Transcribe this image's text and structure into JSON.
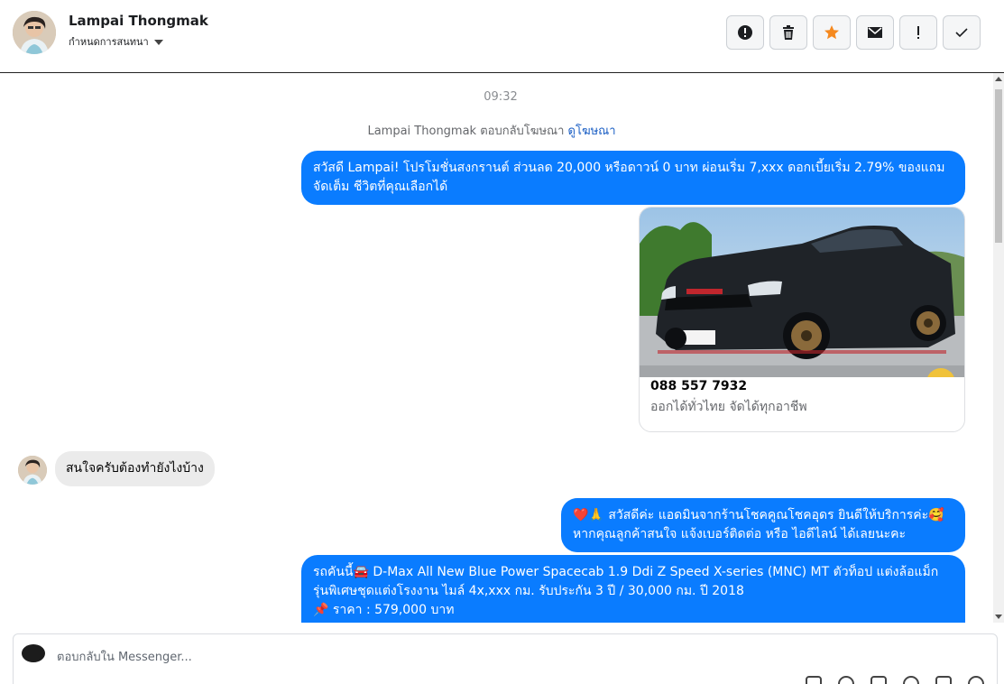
{
  "header": {
    "contact_name": "Lampai Thongmak",
    "assign_label": "กำหนดการสนทนา",
    "actions": [
      {
        "name": "spam-button",
        "icon": "alert-circle-icon"
      },
      {
        "name": "delete-button",
        "icon": "trash-icon"
      },
      {
        "name": "star-button",
        "icon": "star-icon",
        "color": "#f5891f"
      },
      {
        "name": "mark-unread-button",
        "icon": "envelope-icon"
      },
      {
        "name": "follow-up-button",
        "icon": "exclamation-icon"
      },
      {
        "name": "mark-done-button",
        "icon": "check-icon"
      }
    ]
  },
  "conversation": {
    "timestamp": "09:32",
    "ad_note_text": "Lampai Thongmak ตอบกลับโฆษณา",
    "ad_note_link": "ดูโฆษณา",
    "messages": [
      {
        "from": "page",
        "text": "สวัสดี Lampai! โปรโมชั่นสงกรานต์ ส่วนลด 20,000 หรือดาวน์ 0 บาท ผ่อนเริ่ม 7,xxx ดอกเบี้ยเริ่ม 2.79% ของแถมจัดเต็ม ชีวิตที่คุณเลือกได้"
      },
      {
        "from": "page",
        "type": "card",
        "phone": "088 557 7932",
        "tagline": "ออกได้ทั่วไทย จัดได้ทุกอาชีพ"
      },
      {
        "from": "customer",
        "text": "สนใจครับต้องทำยังไงบ้าง"
      },
      {
        "from": "page",
        "text": "❤️🙏 สวัสดีค่ะ แอดมินจากร้านโชคคูณโชคอุดร ยินดีให้บริการค่ะ🥰 หากคุณลูกค้าสนใจ แจ้งเบอร์ติดต่อ หรือ ไอดีไลน์ ได้เลยนะคะ"
      },
      {
        "from": "page",
        "text": "รถคันนี้🚘 D-Max All New Blue Power Spacecab 1.9 Ddi Z Speed X-series (MNC) MT ตัวท็อป แต่งล้อแม็ก รุ่นพิเศษชุดแต่งโรงงาน ไมล์ 4x,xxx กม. รับประกัน 3 ปี / 30,000 กม. ปี 2018",
        "line2": "📌 ราคา : 579,000 บาท"
      }
    ]
  },
  "composer": {
    "placeholder": "ตอบกลับใน Messenger..."
  },
  "colors": {
    "outgoing_bubble": "#0a7cff",
    "incoming_bubble": "#ebebeb",
    "link": "#1a5ec4"
  }
}
